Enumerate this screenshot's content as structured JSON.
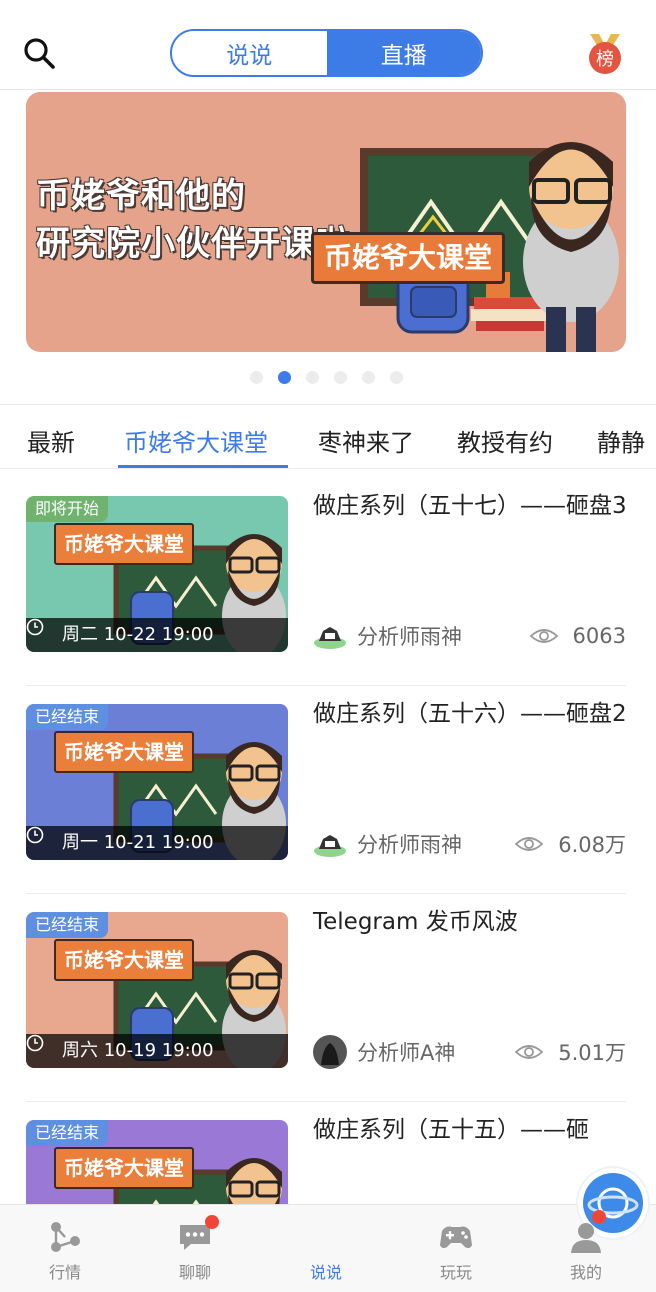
{
  "header": {
    "tabs": [
      "说说",
      "直播"
    ],
    "active_tab": "直播",
    "rank_label": "榜"
  },
  "banner": {
    "headline_line1": "币姥爷和他的",
    "headline_line2": "研究院小伙伴开课啦",
    "tag": "币姥爷大课堂",
    "dot_count": 6,
    "active_dot": 1
  },
  "categories": {
    "items": [
      "最新",
      "币姥爷大课堂",
      "枣神来了",
      "教授有约",
      "静静"
    ],
    "active": "币姥爷大课堂"
  },
  "feed": [
    {
      "badge": "即将开始",
      "thumb_tag": "币姥爷大课堂",
      "time": "周二 10-22 19:00",
      "title": "做庄系列（五十七）——砸盘3",
      "author": "分析师雨神",
      "views": "6063",
      "thumb_color": "#78c8b0"
    },
    {
      "badge": "已经结束",
      "thumb_tag": "币姥爷大课堂",
      "time": "周一 10-21 19:00",
      "title": "做庄系列（五十六）——砸盘2",
      "author": "分析师雨神",
      "views": "6.08万",
      "thumb_color": "#6b7fd6"
    },
    {
      "badge": "已经结束",
      "thumb_tag": "币姥爷大课堂",
      "time": "周六 10-19 19:00",
      "title": "Telegram 发币风波",
      "author": "分析师A神",
      "views": "5.01万",
      "thumb_color": "#e7a88f"
    },
    {
      "badge": "已经结束",
      "thumb_tag": "币姥爷大课堂",
      "time": "",
      "title": "做庄系列（五十五）——砸",
      "author": "",
      "views": "",
      "thumb_color": "#9a78d6"
    }
  ],
  "bottom_nav": {
    "items": [
      "行情",
      "聊聊",
      "说说",
      "玩玩",
      "我的"
    ],
    "active": "说说"
  },
  "colors": {
    "accent": "#3d7be6",
    "badge_red": "#f0463a"
  }
}
